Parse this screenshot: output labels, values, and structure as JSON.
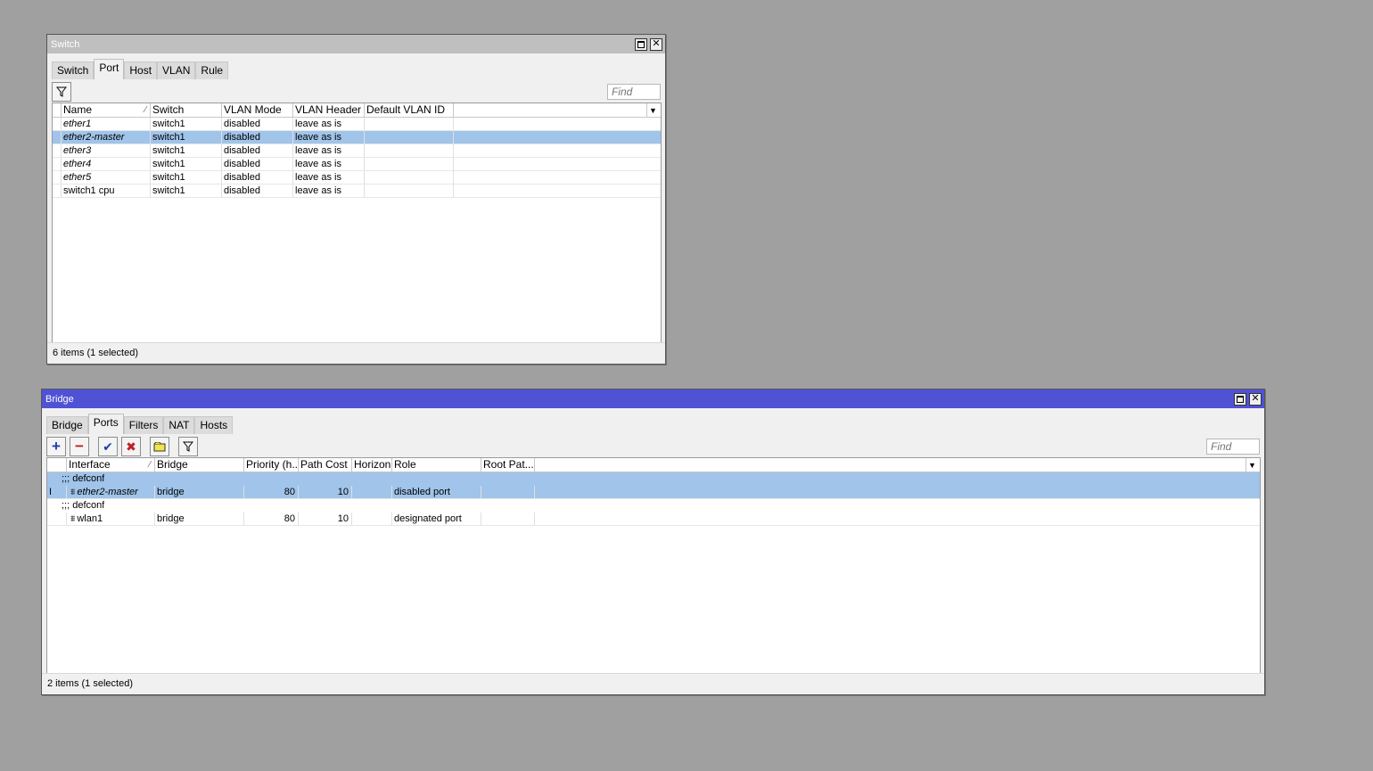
{
  "switch_window": {
    "title": "Switch",
    "tabs": [
      "Switch",
      "Port",
      "Host",
      "VLAN",
      "Rule"
    ],
    "selected_tab": "Port",
    "find_placeholder": "Find",
    "columns": [
      "Name",
      "Switch",
      "VLAN Mode",
      "VLAN Header",
      "Default VLAN ID"
    ],
    "rows": [
      {
        "name": "ether1",
        "switch": "switch1",
        "vlan_mode": "disabled",
        "vlan_header": "leave as is",
        "default_vlan_id": ""
      },
      {
        "name": "ether2-master",
        "switch": "switch1",
        "vlan_mode": "disabled",
        "vlan_header": "leave as is",
        "default_vlan_id": ""
      },
      {
        "name": "ether3",
        "switch": "switch1",
        "vlan_mode": "disabled",
        "vlan_header": "leave as is",
        "default_vlan_id": ""
      },
      {
        "name": "ether4",
        "switch": "switch1",
        "vlan_mode": "disabled",
        "vlan_header": "leave as is",
        "default_vlan_id": ""
      },
      {
        "name": "ether5",
        "switch": "switch1",
        "vlan_mode": "disabled",
        "vlan_header": "leave as is",
        "default_vlan_id": ""
      },
      {
        "name": "switch1 cpu",
        "switch": "switch1",
        "vlan_mode": "disabled",
        "vlan_header": "leave as is",
        "default_vlan_id": ""
      }
    ],
    "status": "6 items (1 selected)"
  },
  "bridge_window": {
    "title": "Bridge",
    "tabs": [
      "Bridge",
      "Ports",
      "Filters",
      "NAT",
      "Hosts"
    ],
    "selected_tab": "Ports",
    "find_placeholder": "Find",
    "columns": [
      "Interface",
      "Bridge",
      "Priority (h...",
      "Path Cost",
      "Horizon",
      "Role",
      "Root Pat..."
    ],
    "comment": ";;; defconf",
    "rows": [
      {
        "flag": "I",
        "interface": "ether2-master",
        "bridge": "bridge",
        "priority": "80",
        "path_cost": "10",
        "horizon": "",
        "role": "disabled port",
        "root_path": ""
      },
      {
        "flag": "",
        "interface": "wlan1",
        "bridge": "bridge",
        "priority": "80",
        "path_cost": "10",
        "horizon": "",
        "role": "designated port",
        "root_path": ""
      }
    ],
    "status": "2 items (1 selected)"
  },
  "icons": {
    "filter": "filter-icon",
    "add": "plus-icon",
    "remove": "minus-icon",
    "enable": "checkmark-icon",
    "disable": "x-icon",
    "comment": "comment-icon"
  },
  "colors": {
    "active_title": "#4f52d4",
    "inactive_title": "#bfbfbf",
    "selection": "#a0c4ea"
  }
}
